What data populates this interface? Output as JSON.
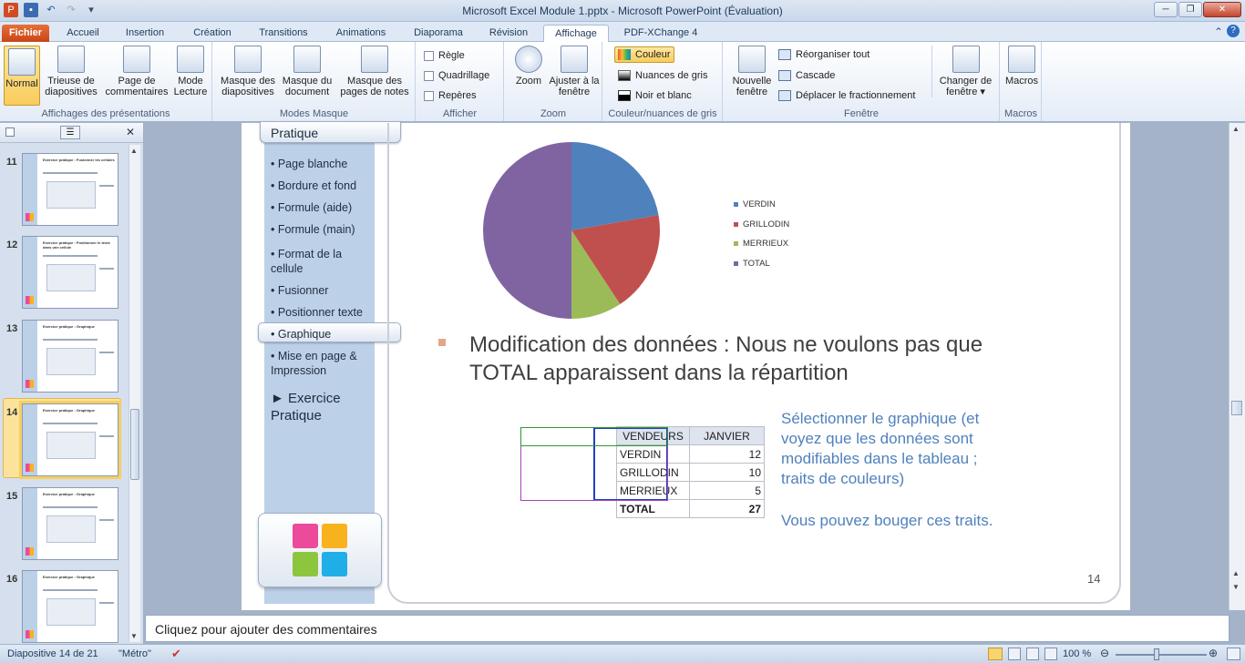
{
  "window": {
    "title": "Microsoft Excel Module 1.pptx - Microsoft PowerPoint (Évaluation)"
  },
  "tabs": [
    "Fichier",
    "Accueil",
    "Insertion",
    "Création",
    "Transitions",
    "Animations",
    "Diaporama",
    "Révision",
    "Affichage",
    "PDF-XChange 4"
  ],
  "active_tab": "Affichage",
  "ribbon": {
    "group1": {
      "label": "Affichages des présentations",
      "buttons": [
        "Normal",
        "Trieuse de diapositives",
        "Page de commentaires",
        "Mode Lecture"
      ]
    },
    "group2": {
      "label": "Modes Masque",
      "buttons": [
        "Masque des diapositives",
        "Masque du document",
        "Masque des pages de notes"
      ]
    },
    "group3": {
      "label": "Afficher",
      "items": [
        "Règle",
        "Quadrillage",
        "Repères"
      ]
    },
    "group4": {
      "label": "Zoom",
      "buttons": [
        "Zoom",
        "Ajuster à la fenêtre"
      ]
    },
    "group5": {
      "label": "Couleur/nuances de gris",
      "items": [
        "Couleur",
        "Nuances de gris",
        "Noir et blanc"
      ]
    },
    "group6": {
      "label": "Fenêtre",
      "big": "Nouvelle fenêtre",
      "items": [
        "Réorganiser tout",
        "Cascade",
        "Déplacer le fractionnement"
      ],
      "switch": "Changer de fenêtre"
    },
    "group7": {
      "label": "Macros",
      "buttons": [
        "Macros"
      ]
    }
  },
  "thumbnails": [
    {
      "num": "11",
      "title": "Exercice pratique : Fusionner les cellules"
    },
    {
      "num": "12",
      "title": "Exercice pratique : Positionner le texte dans une cellule"
    },
    {
      "num": "13",
      "title": "Exercice pratique : Graphique"
    },
    {
      "num": "14",
      "title": "Exercice pratique : Graphique"
    },
    {
      "num": "15",
      "title": "Exercice pratique : Graphique"
    },
    {
      "num": "16",
      "title": "Exercice pratique : Graphique"
    }
  ],
  "slide": {
    "nav_header": "Pratique",
    "nav_items": [
      "• Page blanche",
      "• Bordure et fond",
      "• Formule (aide)",
      "• Formule (main)",
      "• Format de la",
      "cellule",
      "• Fusionner",
      "• Positionner texte",
      "• Graphique",
      "• Mise en page &",
      "Impression"
    ],
    "nav_exercise_1": "► Exercice",
    "nav_exercise_2": "Pratique",
    "bullet_line1": "Modification des données : Nous ne voulons pas que",
    "bullet_line2": "TOTAL apparaissent dans la répartition",
    "tip_lines": [
      "Sélectionner le graphique (et",
      "voyez que les données sont",
      "modifiables dans le tableau ;",
      "traits  de couleurs)"
    ],
    "tip_move": "Vous pouvez bouger ces traits.",
    "page_number": "14",
    "table": {
      "headers": [
        "VENDEURS",
        "JANVIER"
      ],
      "rows": [
        [
          "VERDIN",
          "12"
        ],
        [
          "GRILLODIN",
          "10"
        ],
        [
          "MERRIEUX",
          "5"
        ],
        [
          "TOTAL",
          "27"
        ]
      ]
    }
  },
  "chart_data": {
    "type": "pie",
    "categories": [
      "VERDIN",
      "GRILLODIN",
      "MERRIEUX",
      "TOTAL"
    ],
    "values": [
      12,
      10,
      5,
      27
    ],
    "colors": [
      "#4f81bd",
      "#c0504d",
      "#9bbb59",
      "#8064a2"
    ],
    "legend_position": "right"
  },
  "notes": {
    "placeholder": "Cliquez pour ajouter des commentaires"
  },
  "status": {
    "slide": "Diapositive 14 de 21",
    "theme": "\"Métro\"",
    "zoom": "100 %"
  }
}
